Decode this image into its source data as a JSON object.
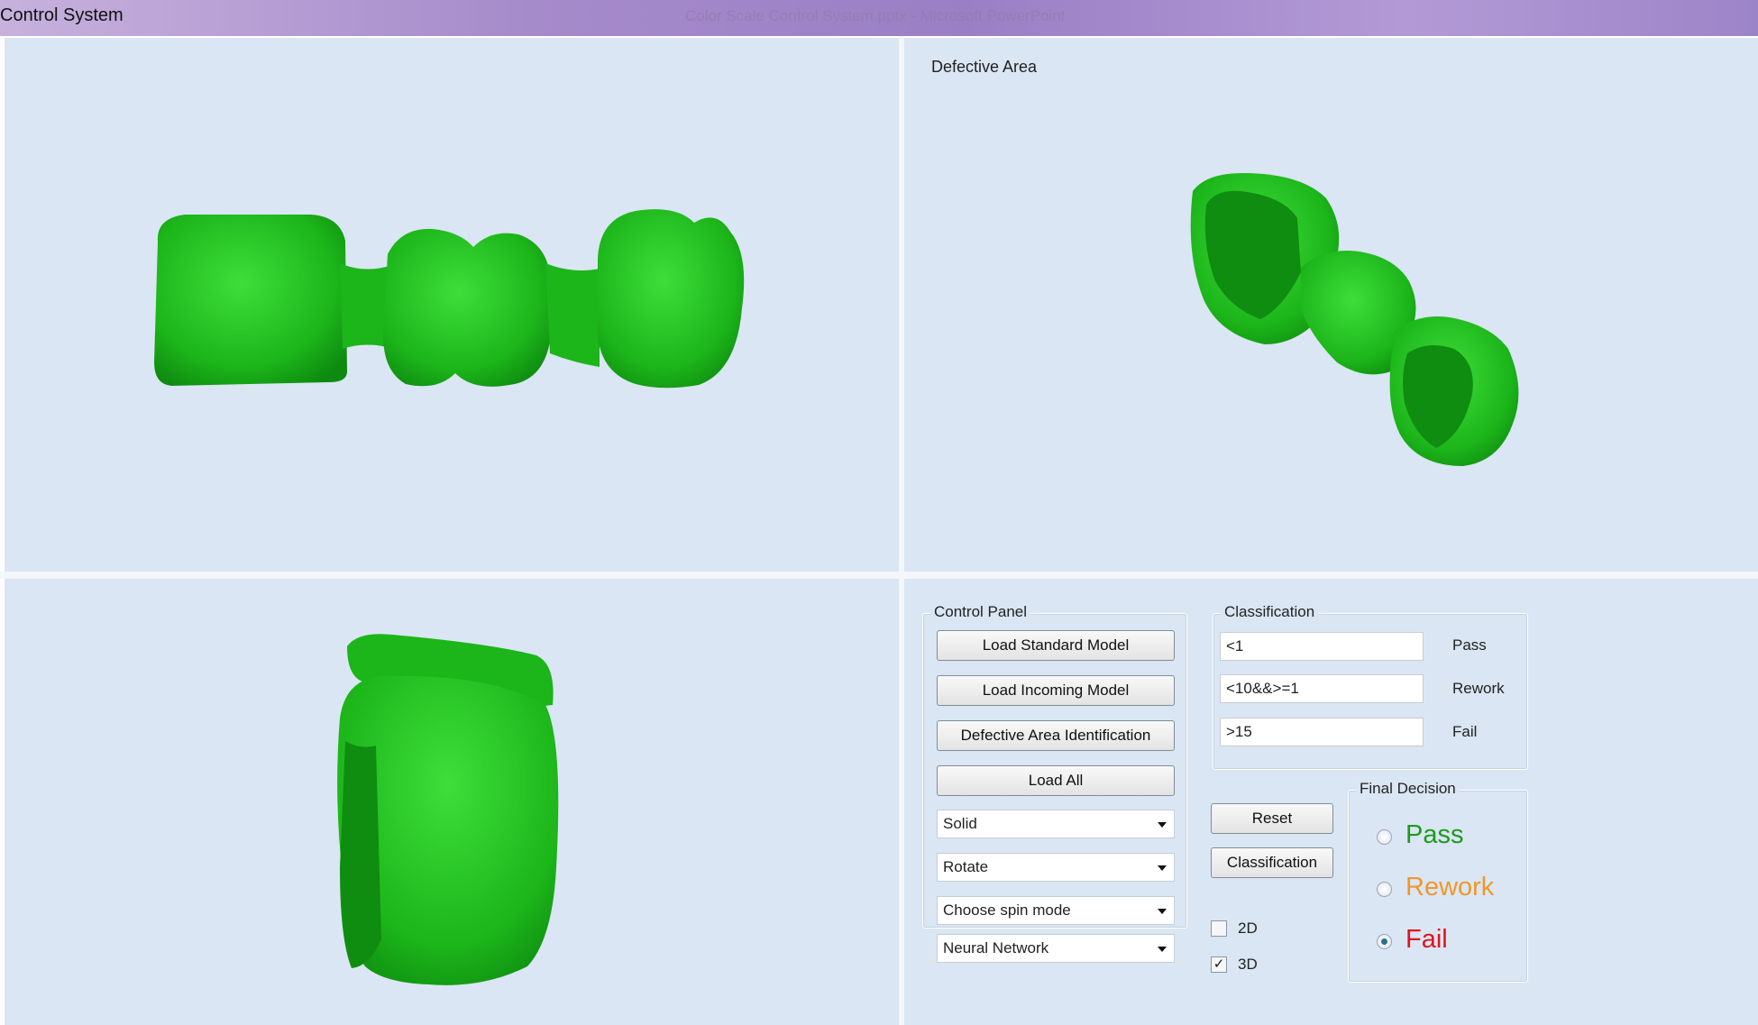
{
  "window": {
    "title": "Control System",
    "center_title": "Color Scale Control System.pptx - Microsoft PowerPoint"
  },
  "viewports": {
    "top_right_label": "Defective Area"
  },
  "model_color": "#22c21f",
  "control_panel": {
    "title": "Control Panel",
    "buttons": {
      "load_standard": "Load Standard Model",
      "load_incoming": "Load Incoming Model",
      "defective_area": "Defective Area Identification",
      "load_all": "Load All"
    },
    "dropdowns": {
      "render_mode": "Solid",
      "interaction": "Rotate",
      "spin_mode": "Choose spin mode",
      "algorithm": "Neural Network"
    }
  },
  "classification": {
    "title": "Classification",
    "rows": [
      {
        "value": "<1",
        "label": "Pass"
      },
      {
        "value": "<10&&>=1",
        "label": "Rework"
      },
      {
        "value": ">15",
        "label": "Fail"
      }
    ],
    "reset_label": "Reset",
    "classify_label": "Classification"
  },
  "view_options": {
    "option_2d": {
      "label": "2D",
      "checked": false
    },
    "option_3d": {
      "label": "3D",
      "checked": true,
      "mark": "✓"
    }
  },
  "final_decision": {
    "title": "Final Decision",
    "options": [
      {
        "label": "Pass",
        "color": "#1e9a1e",
        "checked": false
      },
      {
        "label": "Rework",
        "color": "#f0972a",
        "checked": false
      },
      {
        "label": "Fail",
        "color": "#e0141e",
        "checked": true
      }
    ]
  }
}
